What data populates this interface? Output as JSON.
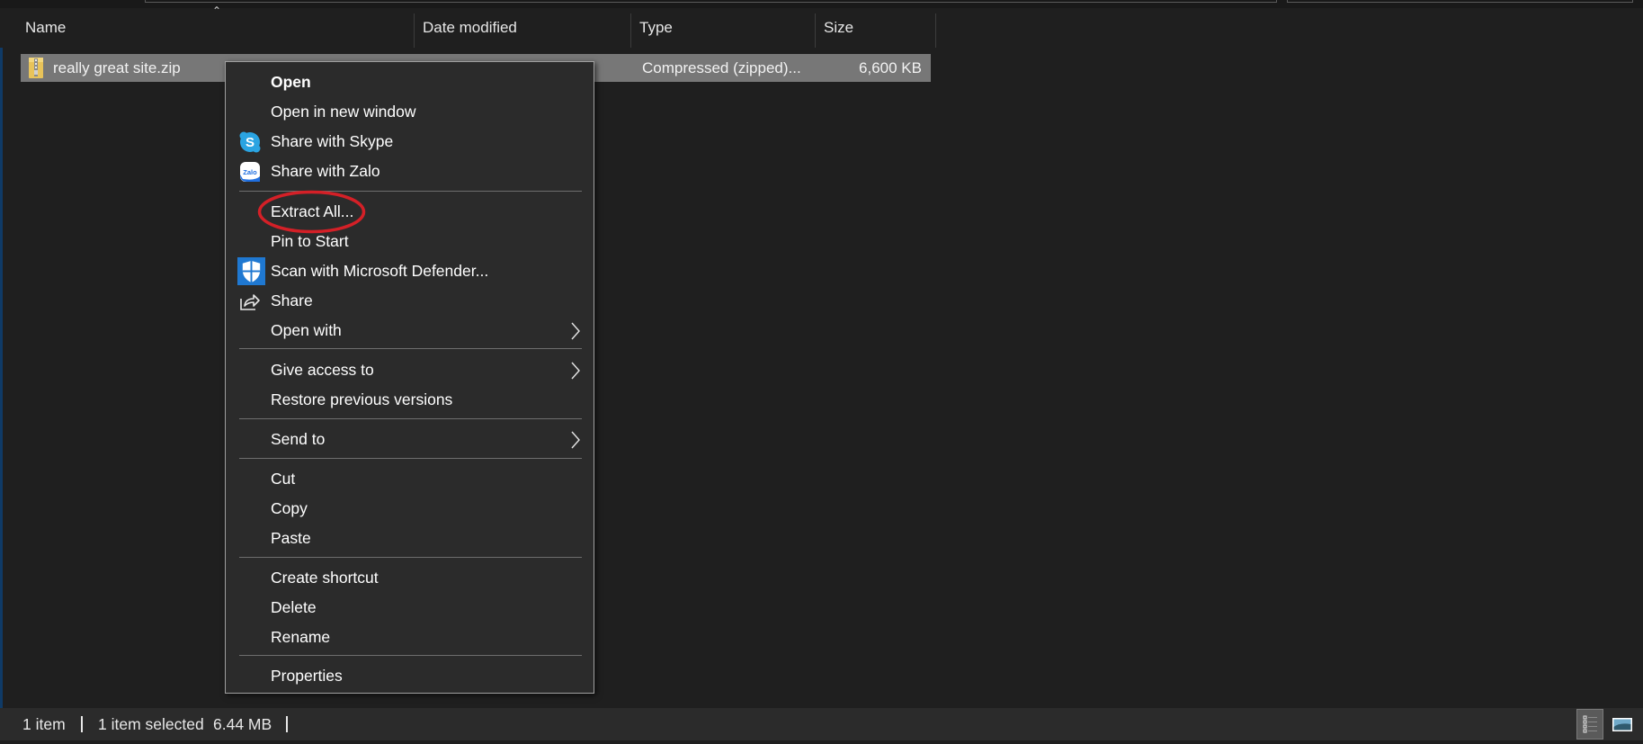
{
  "explorer": {
    "columns": [
      {
        "label": "Name",
        "sorted": "ascending"
      },
      {
        "label": "Date modified"
      },
      {
        "label": "Type"
      },
      {
        "label": "Size"
      }
    ],
    "files": [
      {
        "name": "really great site.zip",
        "date_modified": "",
        "type": "Compressed (zipped)...",
        "size": "6,600 KB",
        "icon": "zip-folder-icon",
        "selected": true
      }
    ]
  },
  "context_menu": {
    "groups": [
      [
        {
          "label": "Open",
          "bold": true
        },
        {
          "label": "Open in new window"
        },
        {
          "label": "Share with Skype",
          "icon": "skype-icon"
        },
        {
          "label": "Share with Zalo",
          "icon": "zalo-icon"
        }
      ],
      [
        {
          "label": "Extract All...",
          "highlighted_annotation": "red-circle"
        },
        {
          "label": "Pin to Start"
        },
        {
          "label": "Scan with Microsoft Defender...",
          "icon": "defender-shield-icon"
        },
        {
          "label": "Share",
          "icon": "share-icon"
        },
        {
          "label": "Open with",
          "submenu": true
        }
      ],
      [
        {
          "label": "Give access to",
          "submenu": true
        },
        {
          "label": "Restore previous versions"
        }
      ],
      [
        {
          "label": "Send to",
          "submenu": true
        }
      ],
      [
        {
          "label": "Cut"
        },
        {
          "label": "Copy"
        },
        {
          "label": "Paste"
        }
      ],
      [
        {
          "label": "Create shortcut"
        },
        {
          "label": "Delete"
        },
        {
          "label": "Rename"
        }
      ],
      [
        {
          "label": "Properties"
        }
      ]
    ]
  },
  "status_bar": {
    "item_count": "1 item",
    "selection": "1 item selected",
    "selection_size": "6.44 MB",
    "views": [
      "details-view-icon",
      "large-icons-view-icon"
    ],
    "active_view": "details-view-icon"
  },
  "annotation": {
    "color": "#d42027"
  }
}
